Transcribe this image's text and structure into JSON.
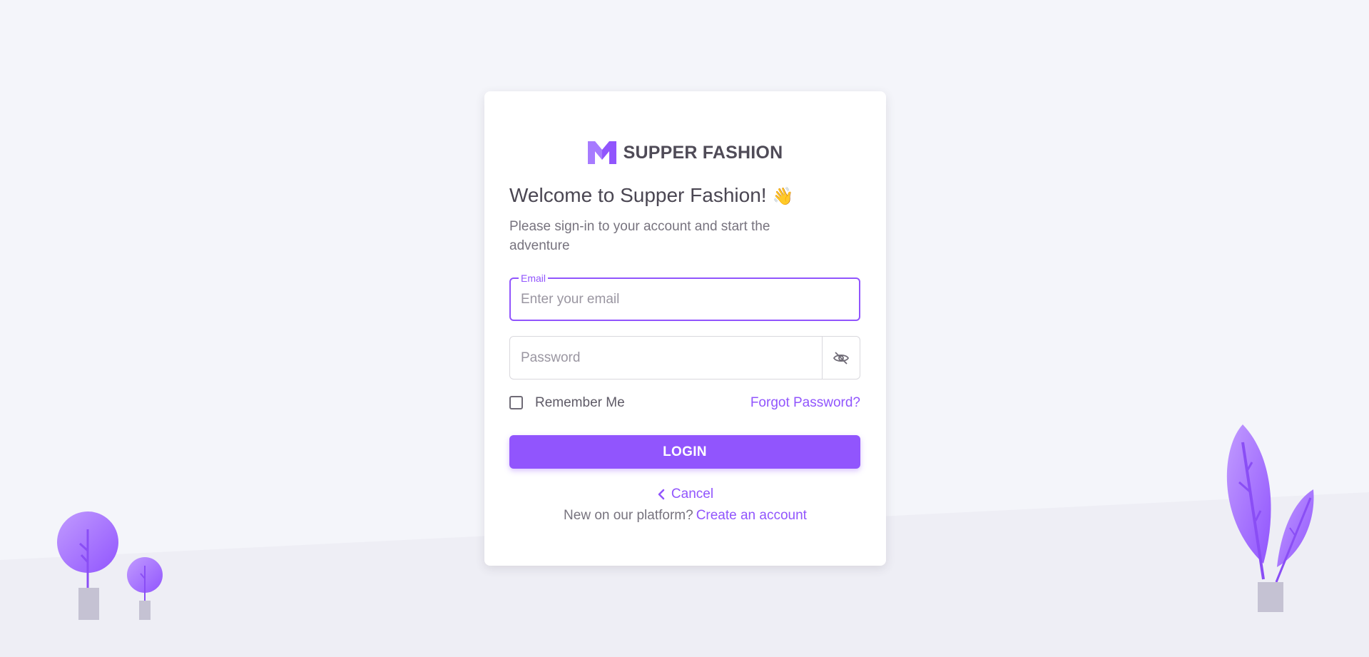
{
  "colors": {
    "primary": "#9155fd",
    "background": "#f4f5fa",
    "card": "#ffffff",
    "text_heading": "#4a4652",
    "text_muted": "#77737e",
    "pot": "#c5c2d3"
  },
  "brand": {
    "name": "SUPPER FASHION",
    "logo_icon": "m-logo-icon"
  },
  "welcome": {
    "title": "Welcome to Supper Fashion!",
    "emoji": "👋",
    "subtitle": "Please sign-in to your account and start the adventure"
  },
  "form": {
    "email": {
      "label": "Email",
      "placeholder": "Enter your email",
      "value": ""
    },
    "password": {
      "placeholder": "Password",
      "value": "",
      "toggle_icon": "eye-off-icon"
    },
    "remember": {
      "label": "Remember Me",
      "checked": false
    },
    "forgot_label": "Forgot Password?",
    "login_label": "LOGIN",
    "cancel_label": "Cancel",
    "cancel_icon": "chevron-left-icon"
  },
  "signup": {
    "prompt": "New on our platform?",
    "link_label": "Create an account"
  }
}
